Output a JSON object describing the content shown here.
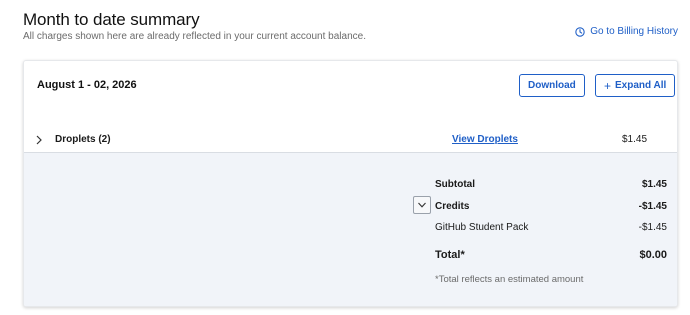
{
  "header": {
    "title": "Month to date summary",
    "subtitle": "All charges shown here are already reflected in your current account balance.",
    "billing_link": "Go to Billing History",
    "billing_icon": "clock-history-icon"
  },
  "card": {
    "period": "August 1 - 02, 2026",
    "download_label": "Download",
    "expand_label": "Expand All",
    "expand_icon": "+",
    "line_item": {
      "name": "Droplets (2)",
      "link": "View Droplets",
      "amount": "$1.45"
    },
    "summary": {
      "subtotal_label": "Subtotal",
      "subtotal_value": "$1.45",
      "credits_label": "Credits",
      "credits_value": "-$1.45",
      "credit_item_label": "GitHub Student Pack",
      "credit_item_value": "-$1.45",
      "total_label": "Total*",
      "total_value": "$0.00",
      "note": "*Total reflects an estimated amount"
    }
  },
  "colors": {
    "accent": "#1f5fc7",
    "summary_bg": "#f1f4f9"
  }
}
